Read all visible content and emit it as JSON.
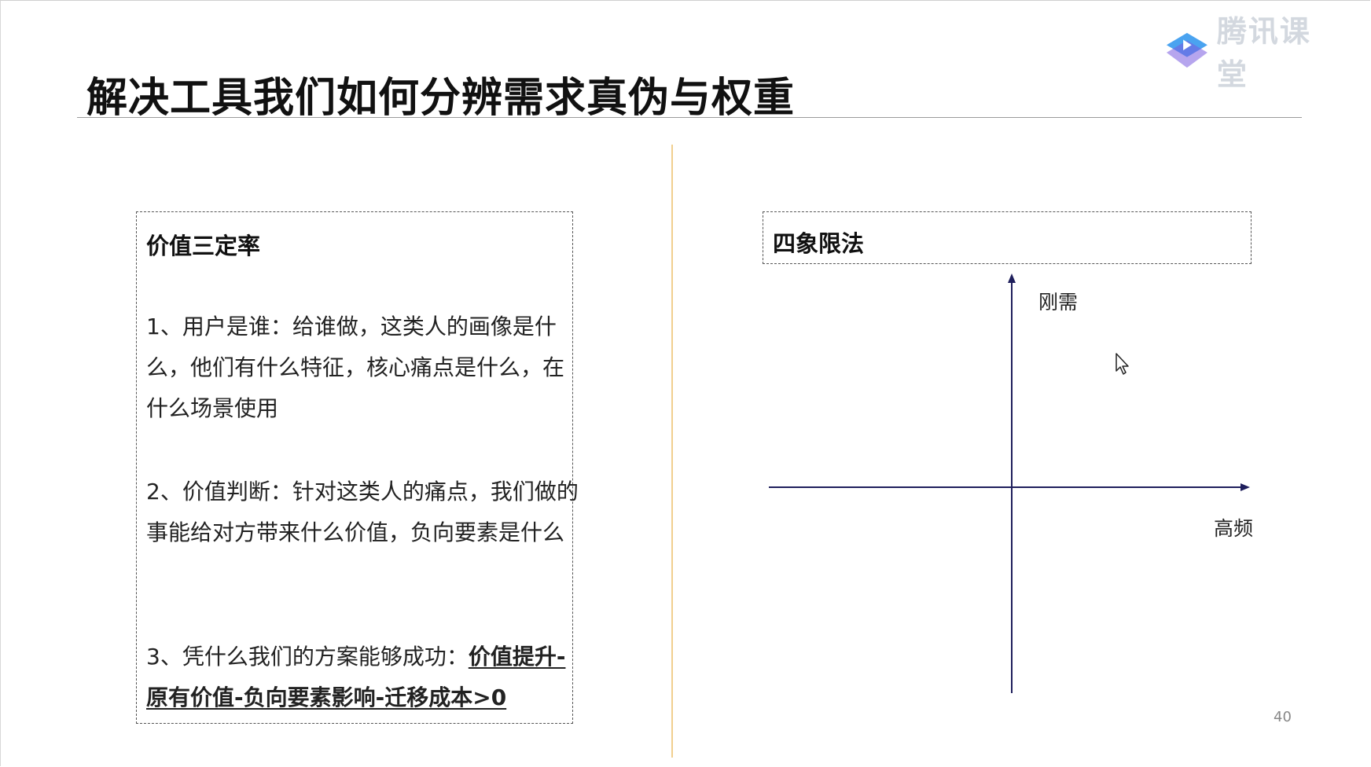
{
  "logo": {
    "text": "腾讯课堂",
    "icon": "tencent-classroom-logo-icon"
  },
  "slide": {
    "title": "解决工具我们如何分辨需求真伪与权重",
    "page_number": "40"
  },
  "left_panel": {
    "heading": "价值三定率",
    "item1": "1、用户是谁：给谁做，这类人的画像是什么，他们有什么特征，核心痛点是什么，在什么场景使用",
    "item2": "2、价值判断：针对这类人的痛点，我们做的事能给对方带来什么价值，负向要素是什么",
    "item3_prefix": "3、凭什么我们的方案能够成功：",
    "item3_emphasis": "价值提升-原有价值-负向要素影响-迁移成本>0"
  },
  "right_panel": {
    "heading": "四象限法",
    "y_axis_label": "刚需",
    "x_axis_label": "高频"
  },
  "colors": {
    "axis": "#1f1f5c",
    "divider": "#f1cf8e",
    "logo_primary": "#4aa3f0",
    "logo_secondary": "#7a5be0"
  }
}
